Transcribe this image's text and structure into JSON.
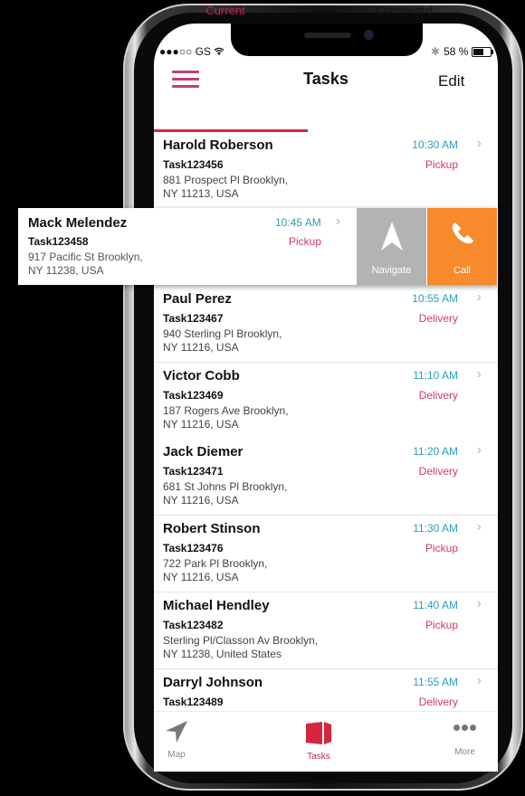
{
  "status_bar": {
    "carrier": "●●●○○ GS",
    "wifi_icon": "wifi-icon",
    "bluetooth_icon": "bluetooth-icon",
    "battery_percent": "58 %",
    "battery_level": 0.58
  },
  "nav": {
    "title": "Tasks",
    "edit_label": "Edit",
    "menu_icon": "hamburger-menu-icon"
  },
  "tabs": [
    {
      "label": "Current",
      "active": true
    },
    {
      "label": "Completed",
      "active": false
    }
  ],
  "colors": {
    "accent": "#d5264a",
    "time": "#2a9fbc",
    "type": "#d03a68",
    "navigate_bg": "#b3b3b3",
    "call_bg": "#f68a2c"
  },
  "tasks": [
    {
      "name": "Harold Roberson",
      "id": "Task123456",
      "address_line1": "881 Prospect Pl Brooklyn,",
      "address_line2": "NY 11213, USA",
      "time": "10:30 AM",
      "type": "Pickup"
    },
    {
      "name": "Mack Melendez",
      "id": "Task123458",
      "address_line1": "917 Pacific St Brooklyn,",
      "address_line2": "NY 11238, USA",
      "time": "10:45 AM",
      "type": "Pickup",
      "swiped": true
    },
    {
      "name": "Paul Perez",
      "id": "Task123467",
      "address_line1": "940 Sterling Pl Brooklyn,",
      "address_line2": "NY 11216, USA",
      "time": "10:55 AM",
      "type": "Delivery"
    },
    {
      "name": "Victor Cobb",
      "id": "Task123469",
      "address_line1": "187 Rogers Ave Brooklyn,",
      "address_line2": "NY 11216, USA",
      "time": "11:10 AM",
      "type": "Delivery"
    },
    {
      "name": "Jack Diemer",
      "id": "Task123471",
      "address_line1": "681 St Johns Pl Brooklyn,",
      "address_line2": "NY 11216, USA",
      "time": "11:20 AM",
      "type": "Delivery"
    },
    {
      "name": "Robert Stinson",
      "id": "Task123476",
      "address_line1": "722 Park Pl Brooklyn,",
      "address_line2": "NY 11216, USA",
      "time": "11:30 AM",
      "type": "Pickup"
    },
    {
      "name": "Michael Hendley",
      "id": "Task123482",
      "address_line1": "Sterling Pl/Classon Av Brooklyn,",
      "address_line2": "NY 11238, United States",
      "time": "11:40 AM",
      "type": "Pickup"
    },
    {
      "name": "Darryl Johnson",
      "id": "Task123489",
      "address_line1": "",
      "address_line2": "",
      "time": "11:55 AM",
      "type": "Delivery"
    }
  ],
  "swipe_actions": {
    "navigate_label": "Navigate",
    "call_label": "Call"
  },
  "tab_bar": [
    {
      "label": "Map",
      "icon": "navigation-arrow-icon",
      "active": false
    },
    {
      "label": "Tasks",
      "icon": "box-icon",
      "active": true
    },
    {
      "label": "More",
      "icon": "more-dots-icon",
      "active": false
    }
  ]
}
